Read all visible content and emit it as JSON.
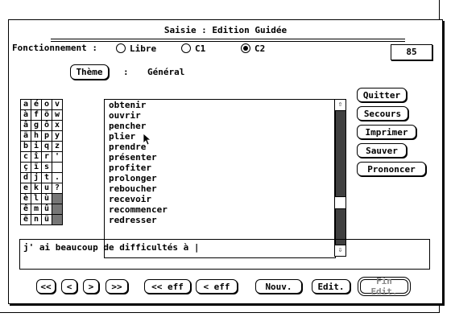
{
  "window": {
    "title": "Saisie : Edition Guidée"
  },
  "mode": {
    "label": "Fonctionnement :",
    "options": [
      {
        "label": "Libre",
        "selected": false
      },
      {
        "label": "C1",
        "selected": false
      },
      {
        "label": "C2",
        "selected": true
      }
    ]
  },
  "counter": "85",
  "theme": {
    "button_label": "Thème",
    "separator": ":",
    "value": "Général"
  },
  "letter_grid": [
    [
      "a",
      "é",
      "o",
      "v"
    ],
    [
      "à",
      "f",
      "ö",
      "w"
    ],
    [
      "â",
      "g",
      "ô",
      "x"
    ],
    [
      "ä",
      "h",
      "p",
      "y"
    ],
    [
      "b",
      "i",
      "q",
      "z"
    ],
    [
      "c",
      "î",
      "r",
      "'"
    ],
    [
      "ç",
      "ï",
      "s",
      ""
    ],
    [
      "d",
      "j",
      "t",
      "."
    ],
    [
      "e",
      "k",
      "u",
      "?"
    ],
    [
      "è",
      "l",
      "ù",
      ""
    ],
    [
      "ê",
      "m",
      "û",
      ""
    ],
    [
      "ë",
      "n",
      "ü",
      ""
    ]
  ],
  "word_list": [
    "obtenir",
    "ouvrir",
    "pencher",
    "plier",
    "prendre",
    "présenter",
    "profiter",
    "prolonger",
    "reboucher",
    "recevoir",
    "recommencer",
    "redresser"
  ],
  "side_buttons": [
    "Quitter",
    "Secours",
    "Imprimer",
    "Sauver",
    "Prononcer"
  ],
  "text_value": "j' ai beaucoup de difficultés à |",
  "bottom_buttons": {
    "first": "<<",
    "prev": "<",
    "next": ">",
    "last": ">>",
    "erase_all": "<< eff",
    "erase_one": "< eff",
    "new": "Nouv.",
    "edit": "Edit.",
    "end_edit": "Fin Edit."
  }
}
